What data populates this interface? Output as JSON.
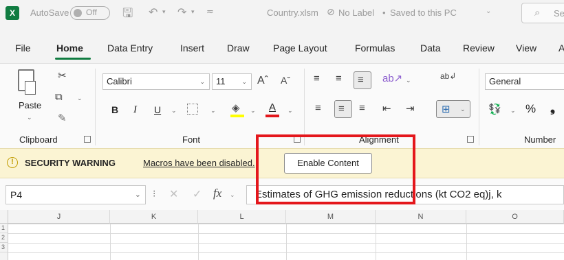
{
  "titlebar": {
    "app_icon": "X",
    "autosave_label": "AutoSave",
    "autosave_state": "Off",
    "file_name": "Country.xlsm",
    "label_status": "No Label",
    "save_status": "Saved to this PC",
    "search_placeholder": "Se"
  },
  "menu": [
    "File",
    "Home",
    "Data Entry",
    "Insert",
    "Draw",
    "Page Layout",
    "Formulas",
    "Data",
    "Review",
    "View",
    "A"
  ],
  "ribbon": {
    "paste_label": "Paste",
    "font_name": "Calibri",
    "font_size": "11",
    "bold": "B",
    "italic": "I",
    "underline": "U",
    "number_format": "General",
    "percent": "%",
    "groups": {
      "clipboard": "Clipboard",
      "font": "Font",
      "alignment": "Alignment",
      "number": "Number"
    }
  },
  "security": {
    "title": "SECURITY WARNING",
    "message": "Macros have been disabled.",
    "button": "Enable Content"
  },
  "formula_bar": {
    "cell_ref": "P4",
    "fx": "fx",
    "content": "Estimates of GHG emission reductions (kt CO2 eq)j, k"
  },
  "grid": {
    "columns": [
      "J",
      "K",
      "L",
      "M",
      "N",
      "O"
    ],
    "rows": [
      "1",
      "2",
      "3"
    ]
  },
  "colors": {
    "excel_green": "#107c41",
    "warning_bg": "#fbf4d3",
    "highlight_red": "#e4171c"
  }
}
